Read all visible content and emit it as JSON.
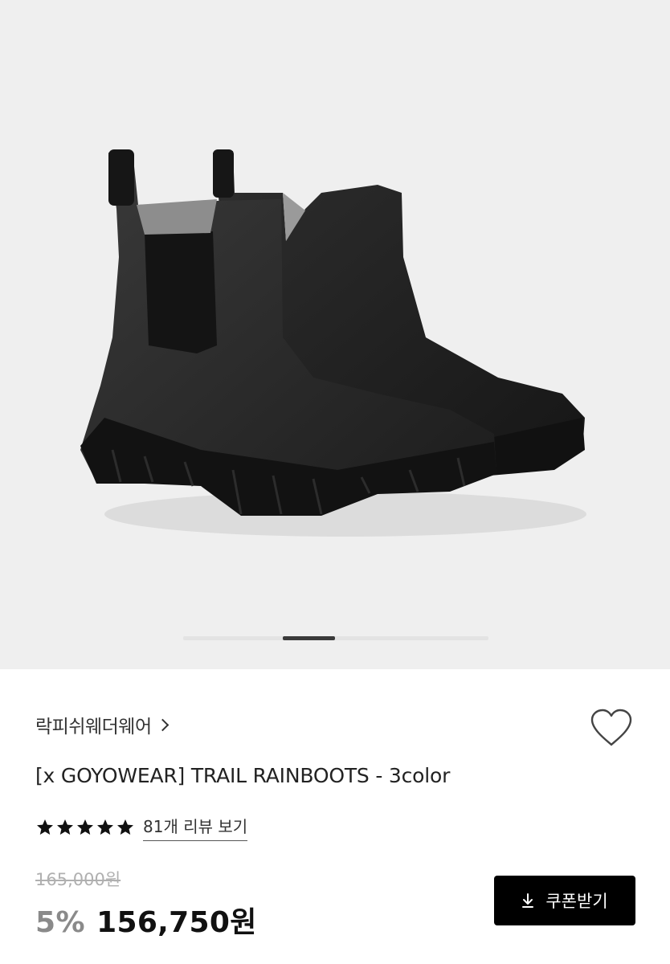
{
  "product_image": {
    "alt": "",
    "pager": {
      "total": 6,
      "active": 2
    }
  },
  "product": {
    "brand": "락피쉬웨더웨어",
    "title": "[x GOYOWEAR] TRAIL RAINBOOTS - 3color",
    "rating": 5,
    "review_link": "81개 리뷰 보기",
    "original_price": "165,000원",
    "discount": "5%",
    "price": "156,750원"
  },
  "actions": {
    "coupon_label": "쿠폰받기",
    "wishlist_icon": "heart-outline-icon",
    "coupon_icon": "download-icon"
  },
  "colors": {
    "hero_bg": "#efefef",
    "star": "#111111",
    "button_bg": "#000000",
    "discount": "#8a8a8a"
  }
}
